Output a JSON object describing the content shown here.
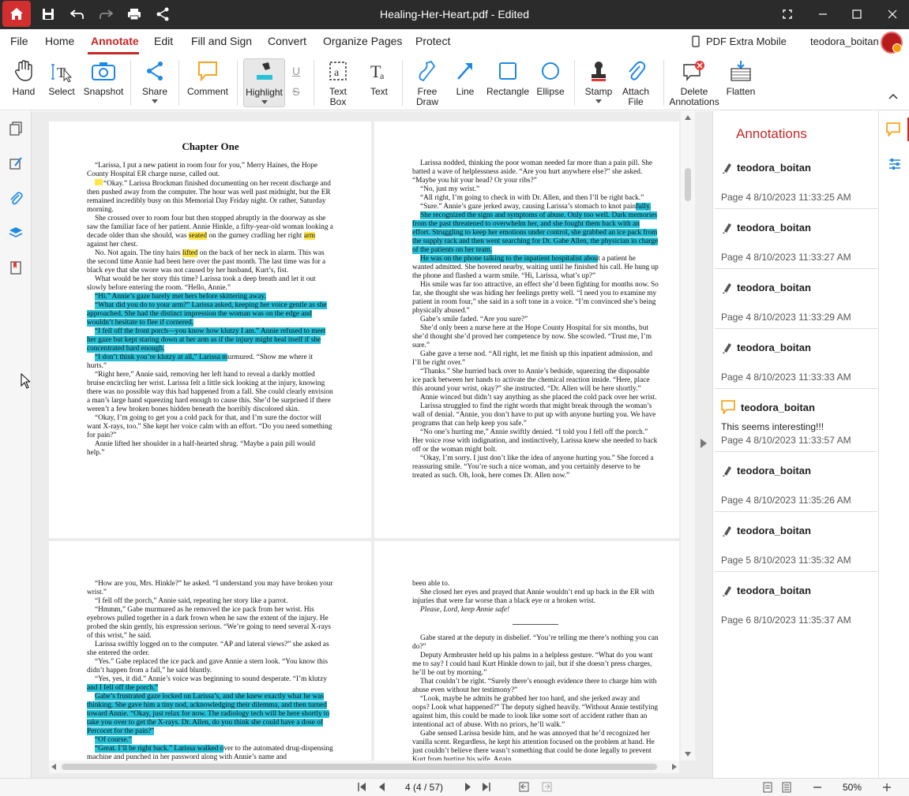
{
  "app": {
    "title": "Healing-Her-Heart.pdf - Edited"
  },
  "menu": {
    "file": "File",
    "home": "Home",
    "annotate": "Annotate",
    "edit": "Edit",
    "fill_sign": "Fill and Sign",
    "convert": "Convert",
    "organize": "Organize Pages",
    "protect": "Protect",
    "mobile": "PDF Extra Mobile",
    "user": "teodora_boitan"
  },
  "tools": {
    "hand": "Hand",
    "select": "Select",
    "snapshot": "Snapshot",
    "share": "Share",
    "comment": "Comment",
    "highlight": "Highlight",
    "textbox1": "Text",
    "textbox2": "Box",
    "text": "Text",
    "freedraw1": "Free",
    "freedraw2": "Draw",
    "line": "Line",
    "rectangle": "Rectangle",
    "ellipse": "Ellipse",
    "stamp": "Stamp",
    "attach1": "Attach",
    "attach2": "File",
    "delete1": "Delete",
    "delete2": "Annotations",
    "flatten": "Flatten"
  },
  "colors": {
    "accent": "#c62828",
    "highlight_cyan": "#27c1d9",
    "highlight_yellow": "#ffe74a",
    "comment_orange": "#f5a623"
  },
  "pages": {
    "p1": {
      "title": "Chapter One",
      "t1": "“Larissa, I put a new patient in room four for you,” Merry Haines, the Hope County Hospital ER charge nurse, called out.",
      "t2a": "“Okay.” Larissa Brockman finished documenting on her recent discharge and then pushed away from the computer. The hour was well past midnight, but the ER remained incredibly busy on this Memorial Day Friday night. Or rather, Saturday morning.",
      "t3a": "She crossed over to room four but then stopped abruptly in the doorway as she saw the familiar face of her patient. Annie Hinkle, a fifty-year-old woman looking a decade older than she should, was ",
      "t3b": "seated",
      "t3c": " on the gurney cradling her right ",
      "t3d": "arm",
      "t3e": " against her chest.",
      "t4a": "No. Not again. The tiny hairs ",
      "t4b": "lifted",
      "t4c": " on the back of her neck in alarm. This was the second time Annie had been here over the past month. The last time was for a black eye that she swore was not caused by her husband, Kurt’s, fist.",
      "t5": "What would be her story this time? Larissa took a deep breath and let it out slowly before entering the room. “Hello, Annie.”",
      "h1": "“Hi.” Annie’s gaze barely met hers before skittering away.",
      "h2": "“What did you do to your arm?” Larissa asked, keeping her voice gentle as she approached. She had the distinct impression the woman was on the edge and wouldn’t hesitate to flee if cornered.",
      "h3": "“I fell off the front porch—you know how klutzy I am.” Annie refused to meet her gaze but kept staring down at her arm as if the injury might heal itself if she concentrated hard enough.",
      "h4a": "“I don’t think you’re klutzy at all,” Larissa m",
      "h4b": "urmured. “Show me where it hurts.”",
      "t6": "“Right here,” Annie said, removing her left hand to reveal a darkly mottled bruise encircling her wrist. Larissa felt a little sick looking at the injury, knowing there was no possible way this had happened from a fall. She could clearly envision a man’s large hand squeezing hard enough to cause this. She’d be surprised if there weren’t a few broken bones hidden beneath the horribly discolored skin.",
      "t7": "“Okay, I’m going to get you a cold pack for that, and I’m sure the doctor will want X-rays, too.” She kept her voice calm with an effort. “Do you need something for pain?”",
      "t8": "Annie lifted her shoulder in a half-hearted shrug. “Maybe a pain pill would help.”"
    },
    "p2": {
      "t1": "Larissa nodded, thinking the poor woman needed far more than a pain pill. She batted a wave of helplessness aside. “Are you hurt anywhere else?” she asked. “Maybe you hit your head? Or your ribs?”",
      "t2": "“No, just my wrist.”",
      "t3": "“All right, I’m going to check in with Dr. Allen, and then I’ll be right back.”",
      "t4a": "“Sure.” Annie’s gaze jerked away, causing Larissa’s stomach to knot pain",
      "t4b": "fully.",
      "h1": "She recognized the signs and symptoms of abuse. Only too well. Dark memories from the past threatened to overwhelm her, and she fought them back with an effort. Struggling to keep her emotions under control, she grabbed an ice pack from the supply rack and then went searching for Dr. Gabe Allen, the physician in charge of the patients on her team.",
      "h2a": "He was on the phone talking to the inpatient hospitalist abou",
      "h2b": "t a patient he wanted admitted. She hovered nearby, waiting until he finished his call. He hung up the phone and flashed a warm smile. “Hi, Larissa, what’s up?”",
      "t5": "His smile was far too attractive, an effect she’d been fighting for months now. So far, she thought she was hiding her feelings pretty well. “I need you to examine my patient in room four,” she said in a soft tone in a voice. “I’m convinced she’s being physically abused.”",
      "t6": "Gabe’s smile faded. “Are you sure?”",
      "t7": "She’d only been a nurse here at the Hope County Hospital for six months, but she’d thought she’d proved her competence by now. She scowled. “Trust me, I’m sure.”",
      "t8": "Gabe gave a terse nod. “All right, let me finish up this inpatient admission, and I’ll be right over.”",
      "t9": "“Thanks.” She hurried back over to Annie’s bedside, squeezing the disposable ice pack between her hands to activate the chemical reaction inside. “Here, place this around your wrist, okay?” she instructed. “Dr. Allen will be here shortly.”",
      "t10": "Annie winced but didn’t say anything as she placed the cold pack over her wrist.",
      "t11": "Larissa struggled to find the right words that might break through the woman’s wall of denial. “Annie, you don’t have to put up with anyone hurting you. We have programs that can help keep you safe.”",
      "t12": "“No one’s hurting me,” Annie swiftly denied. “I told you I fell off the porch.” Her voice rose with indignation, and instinctively, Larissa knew she needed to back off or the woman might bolt.",
      "t13": "“Okay, I’m sorry. I just don’t like the idea of anyone hurting you.” She forced a reassuring smile. “You’re such a nice woman, and you certainly deserve to be treated as such. Oh, look, here comes Dr. Allen now.”"
    },
    "p3": {
      "t1": "“How are you, Mrs. Hinkle?” he asked. “I understand you may have broken your wrist.”",
      "t2": "“I fell off the porch,” Annie said, repeating her story like a parrot.",
      "t3": "“Hmmm,” Gabe murmured as he removed the ice pack from her wrist. His eyebrows pulled together in a dark frown when he saw the extent of the injury. He probed the skin gently, his expression serious. “We’re going to need several X-rays of this wrist,” he said.",
      "t4": "Larissa swiftly logged on to the computer. “AP and lateral views?” she asked as she entered the order.",
      "t5": "“Yes.” Gabe replaced the ice pack and gave Annie a stern look. “You know this didn’t happen from a fall,” he said bluntly.",
      "t6a": "“Yes, yes, it did.” Annie’s voice was beginning to sound desperate. “I’m klutzy ",
      "t6b": "and I fell off the porch.”",
      "h1": "Gabe’s frustrated gaze locked on Larissa’s, and she knew exactly what he was thinking. She gave him a tiny nod, acknowledging their dilemma, and then turned toward Annie. “Okay, just relax for now. The radiology tech will be here shortly to take you over to get the X-rays. Dr. Allen, do you think she could have a dose of Percocet for the pain?”",
      "h2": "“Of course.”",
      "h3a": "“Great. I’ll be right back.” Larissa walked o",
      "h3b": "ver to the automated drug-dispensing machine and punched in her password along with Annie’s name and"
    },
    "p4": {
      "t1": "been able to.",
      "t2": "She closed her eyes and prayed that Annie wouldn’t end up back in the ER with injuries that were far worse than a black eye or a broken wrist.",
      "t3": "Please, Lord, keep Annie safe!",
      "t4": "Gabe stared at the deputy in disbelief. “You’re telling me there’s nothing you can do?”",
      "t5": "Deputy Armbruster held up his palms in a helpless gesture. “What do you want me to say? I could haul Kurt Hinkle down to jail, but if she doesn’t press charges, he’ll be out by morning.”",
      "t6": "That couldn’t be right. “Surely there’s enough evidence there to charge him with abuse even without her testimony?”",
      "t7": "“Look, maybe he admits he grabbed her too hard, and she jerked away and oops? Look what happened?” The deputy sighed heavily. “Without Annie testifying against him, this could be made to look like some sort of accident rather than an intentional act of abuse. With no priors, he’ll walk.”",
      "t8": "Gabe sensed Larissa beside him, and he was annoyed that he’d recognized her vanilla scent. Regardless, he kept his attention focused on the problem at hand. He just couldn’t believe there wasn’t something that could be done legally to prevent Kurt from hurting his wife. Again."
    }
  },
  "annotations": {
    "header": "Annotations",
    "items": [
      {
        "user": "teodora_boitan",
        "meta": "Page 4   8/10/2023 11:33:25 AM"
      },
      {
        "user": "teodora_boitan",
        "meta": "Page 4   8/10/2023 11:33:27 AM"
      },
      {
        "user": "teodora_boitan",
        "meta": "Page 4   8/10/2023 11:33:29 AM"
      },
      {
        "user": "teodora_boitan",
        "meta": "Page 4   8/10/2023 11:33:33 AM"
      },
      {
        "user": "teodora_boitan",
        "text": "This seems interesting!!!",
        "meta": "Page 4   8/10/2023 11:33:57 AM"
      },
      {
        "user": "teodora_boitan",
        "meta": "Page 4   8/10/2023 11:35:26 AM"
      },
      {
        "user": "teodora_boitan",
        "meta": "Page 5   8/10/2023 11:35:32 AM"
      },
      {
        "user": "teodora_boitan",
        "meta": "Page 6   8/10/2023 11:35:37 AM"
      }
    ]
  },
  "status": {
    "page": "4 (4 / 57)",
    "zoom": "50%"
  }
}
